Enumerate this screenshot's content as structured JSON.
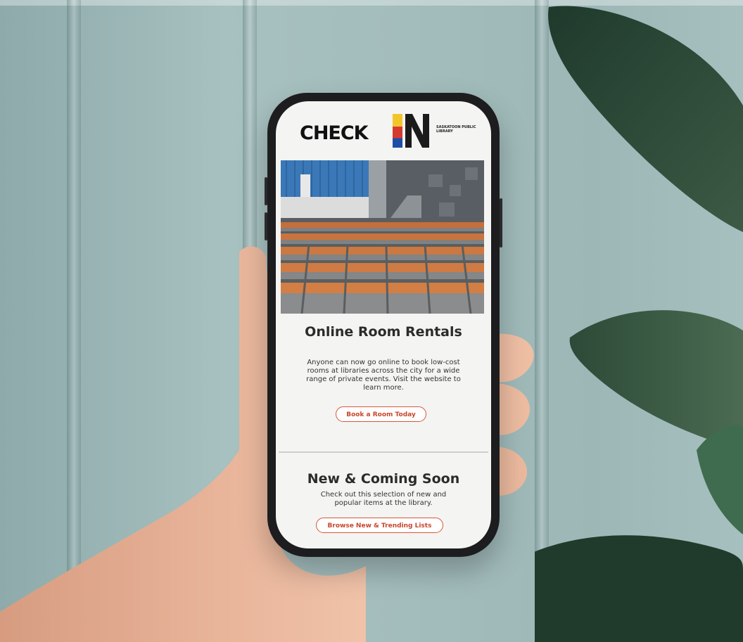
{
  "logo": {
    "check_text": "CHECK",
    "in_text": "IN",
    "library_name": "SASKATOON PUBLIC LIBRARY"
  },
  "section1": {
    "title": "Online Room Rentals",
    "body": "Anyone can now go online to book low-cost rooms at libraries across the city for a wide range of private events. Visit the website to learn more.",
    "button_label": "Book a Room Today"
  },
  "section2": {
    "title": "New & Coming Soon",
    "body": "Check out this selection of new and popular items at the library.",
    "button_label": "Browse New & Trending Lists"
  },
  "colors": {
    "accent": "#d8553b",
    "wall": "#a3bcbc",
    "leaf": "#2f4a3a"
  }
}
